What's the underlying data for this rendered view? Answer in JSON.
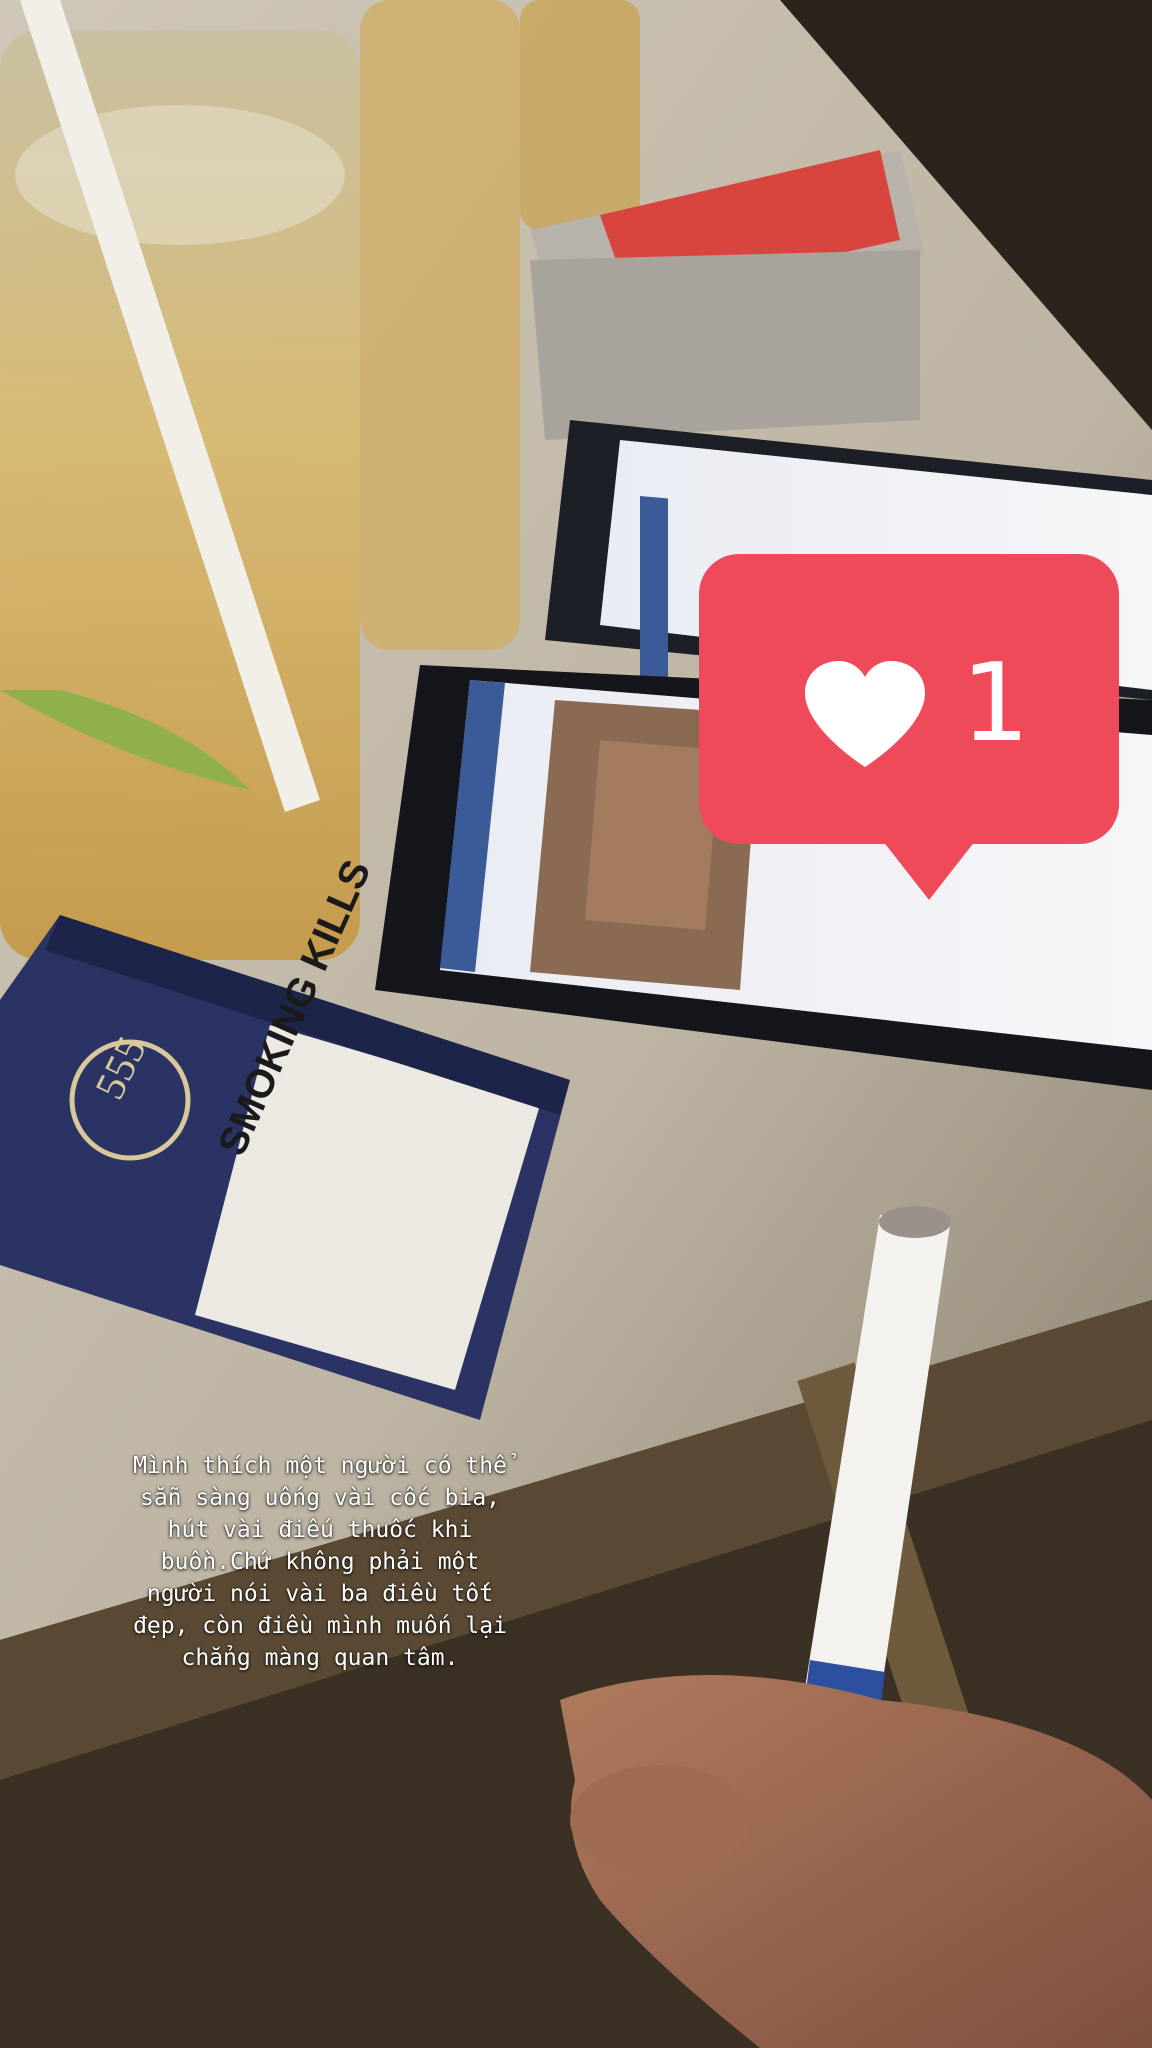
{
  "story": {
    "like_count": "1",
    "caption": "Mình thích một người có thể\nsẵn sàng uống vài cốc bia,\nhút vài điếu thuốc khi\nbuồn.Chứ không phải một\nngười nói vài ba điều tốt\nđẹp, còn điều mình muốn lại\nchẳng màng quan tâm."
  },
  "scene": {
    "cigarette_pack_warning": "SMOKING KILLS",
    "cigarette_pack_brand": "555"
  },
  "colors": {
    "badge": "#ef4a5a",
    "text": "#ffffff",
    "pack_navy": "#2a3364"
  },
  "icons": {
    "like": "heart-icon"
  }
}
